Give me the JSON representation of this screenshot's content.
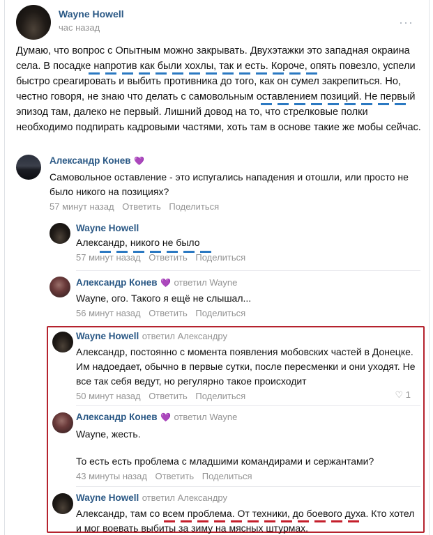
{
  "post": {
    "author": "Wayne Howell",
    "time": "час назад",
    "more": "···",
    "text": "Думаю, что вопрос с Опытным можно закрывать. Двухэтажки это западная окраина села. В посадке напротив как были хохлы, так и есть. Короче, опять повезло, успели быстро среагировать и выбить противника до того, как он сумел закрепиться. Но, честно говоря, не знаю что делать с самовольным оставлением позиций. Не первый эпизод там, далеко не первый. Лишний довод на то, что стрелковые полки необходимо подпирать кадровыми частями, хоть там в основе такие же мобы сейчас."
  },
  "comments": [
    {
      "author": "Александр Конев",
      "emoji": "💜",
      "reply_to": "",
      "text": "Самовольное оставление - это испугались нападения и отошли, или просто не было никого на позициях?",
      "time": "57 минут назад",
      "reply": "Ответить",
      "share": "Поделиться"
    },
    {
      "author": "Wayne Howell",
      "reply_to": "",
      "text": "Александр, никого не было",
      "time": "57 минут назад",
      "reply": "Ответить",
      "share": "Поделиться"
    },
    {
      "author": "Александр Конев",
      "emoji": "💜",
      "reply_to": "ответил Wayne",
      "text": "Wayne, ого. Такого я ещё не слышал...",
      "time": "56 минут назад",
      "reply": "Ответить",
      "share": "Поделиться"
    },
    {
      "author": "Wayne Howell",
      "reply_to": "ответил Александру",
      "text": "Александр, постоянно с момента появления мобовских частей в Донецке. Им надоедает, обычно в первые сутки, после пересменки и они уходят. Не все так себя ведут, но регулярно такое происходит",
      "time": "50 минут назад",
      "reply": "Ответить",
      "share": "Поделиться",
      "likes": "1"
    },
    {
      "author": "Александр Конев",
      "emoji": "💜",
      "reply_to": "ответил Wayne",
      "text": "Wayne, жесть.",
      "text2": "То есть есть проблема с младшими командирами и сержантами?",
      "time": "43 минуты назад",
      "reply": "Ответить",
      "share": "Поделиться"
    },
    {
      "author": "Wayne Howell",
      "reply_to": "ответил Александру",
      "text": "Александр, там со всем проблема. От техники, до боевого духа. Кто хотел и мог воевать выбиты за зиму на мясных штурмах."
    }
  ],
  "colors": {
    "link": "#2a5885",
    "meta": "#939393",
    "highlight_box": "#b5232e",
    "blue_mark": "#2b79c2",
    "red_mark": "#c41f2c"
  },
  "icons": [
    "more-icon",
    "heart-icon"
  ]
}
